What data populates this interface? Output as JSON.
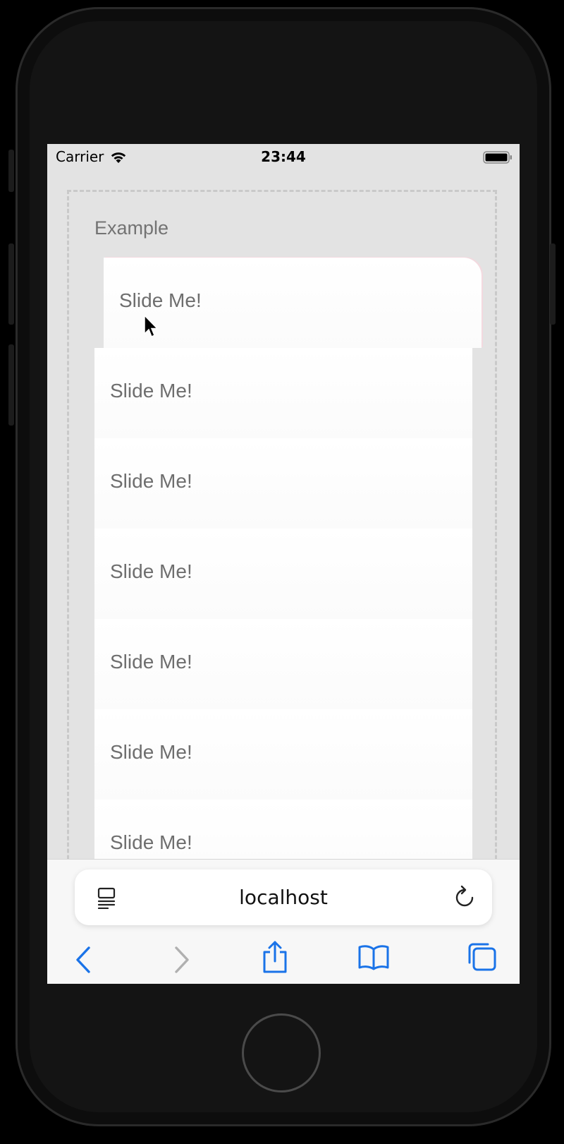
{
  "status_bar": {
    "carrier": "Carrier",
    "time": "23:44",
    "wifi_icon": "wifi-icon",
    "battery_icon": "battery-icon"
  },
  "page": {
    "heading": "Example",
    "items": [
      {
        "label": "Slide Me!"
      },
      {
        "label": "Slide Me!"
      },
      {
        "label": "Slide Me!"
      },
      {
        "label": "Slide Me!"
      },
      {
        "label": "Slide Me!"
      },
      {
        "label": "Slide Me!"
      },
      {
        "label": "Slide Me!"
      }
    ]
  },
  "browser": {
    "url": "localhost",
    "icons": [
      "reader-mode-icon",
      "reload-icon",
      "back-icon",
      "forward-icon",
      "share-icon",
      "bookmarks-icon",
      "tabs-icon"
    ],
    "accent_color": "#1a73e8",
    "disabled_color": "#b0b0b0"
  }
}
